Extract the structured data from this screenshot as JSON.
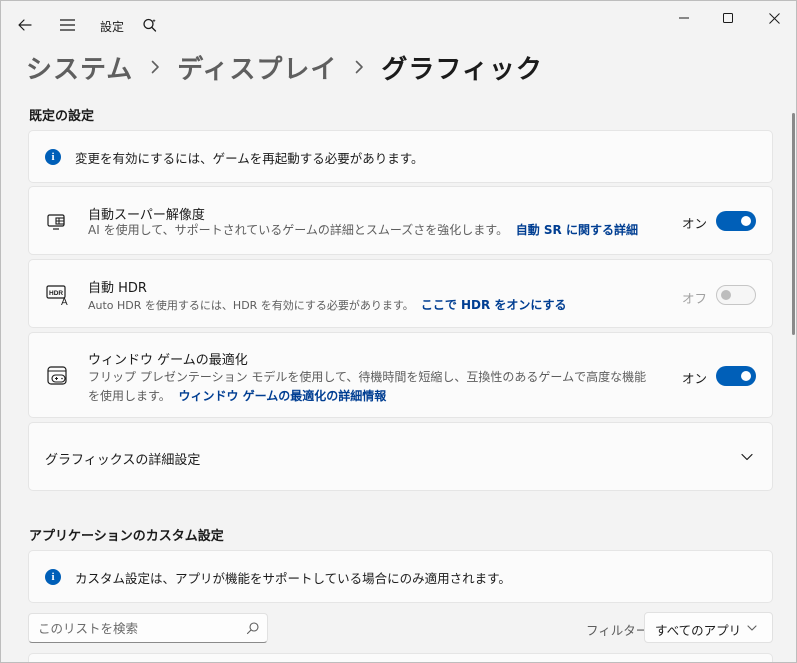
{
  "titlebar": {
    "app_title": "設定",
    "icons": {
      "back": "back-arrow-icon",
      "menu": "hamburger-menu-icon",
      "search": "search-icon"
    }
  },
  "breadcrumb": {
    "items": [
      "システム",
      "ディスプレイ",
      "グラフィック"
    ]
  },
  "defaults_section": {
    "heading": "既定の設定",
    "info_text": "変更を有効にするには、ゲームを再起動する必要があります。",
    "rows": [
      {
        "title": "自動スーパー解像度",
        "description": "AI を使用して、サポートされているゲームの詳細とスムーズさを強化します。",
        "link": "自動 SR に関する詳細",
        "toggle_state": "オン",
        "enabled": true,
        "icon": "super-resolution-icon"
      },
      {
        "title": "自動 HDR",
        "description": "Auto HDR を使用するには、HDR を有効にする必要があります。",
        "link": "ここで HDR をオンにする",
        "toggle_state": "オフ",
        "enabled": false,
        "icon": "hdr-icon"
      },
      {
        "title": "ウィンドウ ゲームの最適化",
        "description": "フリップ プレゼンテーション モデルを使用して、待機時間を短縮し、互換性のあるゲームで高度な機能を使用します。",
        "link": "ウィンドウ ゲームの最適化の詳細情報",
        "toggle_state": "オン",
        "enabled": true,
        "icon": "game-window-icon"
      }
    ],
    "advanced": {
      "title": "グラフィックスの詳細設定"
    }
  },
  "apps_section": {
    "heading": "アプリケーションのカスタム設定",
    "info_text": "カスタム設定は、アプリが機能をサポートしている場合にのみ適用されます。",
    "search_placeholder": "このリストを検索",
    "filter_label": "フィルター:",
    "filter_value": "すべてのアプリ"
  },
  "colors": {
    "accent": "#005fb8",
    "link": "#003e92",
    "background": "#f3f3f3",
    "card": "#fbfbfb"
  }
}
